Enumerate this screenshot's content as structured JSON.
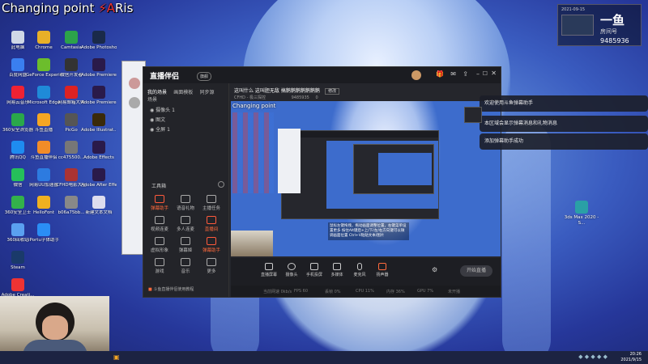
{
  "overlay": {
    "title_a": "Changing point ",
    "title_b": "Ris",
    "title_mark": "⚡A"
  },
  "desktop_icons": [
    {
      "label": "此电脑",
      "color": "#cfd8e6"
    },
    {
      "label": "百度网盘",
      "color": "#3a7ff0"
    },
    {
      "label": "网易云音乐",
      "color": "#e23"
    },
    {
      "label": "360安全浏览器",
      "color": "#2aa84a"
    },
    {
      "label": "腾讯QQ",
      "color": "#1e8cf0"
    },
    {
      "label": "微信",
      "color": "#25c05a"
    },
    {
      "label": "360安全卫士",
      "color": "#33b14a"
    },
    {
      "label": "360回收站",
      "color": "#5aa0f0"
    },
    {
      "label": "Steam",
      "color": "#1a3a6a"
    },
    {
      "label": "Adobe Creati...",
      "color": "#e33"
    },
    {
      "label": "",
      "color": "#e33"
    }
  ],
  "desktop_icons_col2": [
    {
      "label": "Chrome",
      "color": "#e8b028"
    },
    {
      "label": "GeForce Experience",
      "color": "#6cbd2c"
    },
    {
      "label": "Microsoft Edge",
      "color": "#1f8ad8"
    },
    {
      "label": "斗鱼直播",
      "color": "#f5a623"
    },
    {
      "label": "斗鱼直播伴侣",
      "color": "#f28c28"
    },
    {
      "label": "网易UU加速器",
      "color": "#2d7be0"
    },
    {
      "label": "HelloFont",
      "color": "#f0b020"
    },
    {
      "label": "iPortu字体助手",
      "color": "#2a8ef5"
    }
  ],
  "desktop_icons_col3": [
    {
      "label": "Camtasia",
      "color": "#2ca24a"
    },
    {
      "label": "微信开发者",
      "color": "#333"
    },
    {
      "label": "网易邮箱大师",
      "color": "#d22"
    },
    {
      "label": "PicGo",
      "color": "#555"
    },
    {
      "label": "cc475500...",
      "color": "#777"
    },
    {
      "label": "CFHD电影大王",
      "color": "#a33"
    },
    {
      "label": "b06a75bb...",
      "color": "#888"
    }
  ],
  "desktop_icons_col4": [
    {
      "label": "Adobe Photosho...",
      "color": "#1a2a4a"
    },
    {
      "label": "Adobe Premiere",
      "color": "#2a1a4a"
    },
    {
      "label": "Adobe Premiere Pro",
      "color": "#2a1a4a"
    },
    {
      "label": "Adobe Illustrat...",
      "color": "#3a2a0a"
    },
    {
      "label": "Adobe Effects",
      "color": "#2a1a4a"
    },
    {
      "label": "Adobe After Effects 2020",
      "color": "#2a1a4a"
    },
    {
      "label": "新建文本文档",
      "color": "#dde"
    }
  ],
  "app": {
    "logo": "直播伴侣",
    "badge": "旗舰",
    "tabs": [
      "我的场景",
      "画面模板",
      "同步源",
      "场景"
    ],
    "scenes": [
      "摄像头 1",
      "图文",
      "全屏 1"
    ],
    "room_title": "这叫什么 这叫胆无敌 搞鹅鹅鹅鹅鹅鹅鹅",
    "room_btn": "修改",
    "category": "CFHD - 极三探控",
    "room_no": "9485935",
    "fans": "0",
    "toolbox_label": "工具箱",
    "tools": [
      {
        "label": "弹幕助手",
        "hot": true
      },
      {
        "label": "语音礼物",
        "hot": false
      },
      {
        "label": "主播任务",
        "hot": false
      },
      {
        "label": "视频连麦",
        "hot": false
      },
      {
        "label": "多人连麦",
        "hot": false
      },
      {
        "label": "直播间",
        "hot": true
      },
      {
        "label": "虚拟形象",
        "hot": false
      },
      {
        "label": "弹幕姬",
        "hot": false
      },
      {
        "label": "弹幕助手",
        "hot": true
      },
      {
        "label": "游戏",
        "hot": false
      },
      {
        "label": "音乐",
        "hot": false
      },
      {
        "label": "更多",
        "hot": false
      }
    ],
    "footer_tip": "斗鱼直播伴侣使用教程",
    "controls": [
      "直播屏幕",
      "摄像头",
      "手机投屏",
      "多媒体",
      "麦克风",
      "扬声器"
    ],
    "start_btn": "开始直播",
    "preview_caption": "Changing point",
    "stream_tip": "鼠标左键拖拽，拖动画面调整位置，右键菜单设置更多 按住Alt键后+上/下/左/右方向键可以微调画面位置 Ctrl+V粘贴文本/图片",
    "status": [
      "当前网速 0kb/s",
      "FPS 60",
      "丢帧 0%",
      "CPU 11%",
      "内存 36%",
      "GPU 7%",
      "未开播"
    ]
  },
  "notifications": [
    "欢迎使用斗鱼弹幕助手",
    "本区域会显示弹幕消息和礼物消息",
    "添加弹幕助手成功"
  ],
  "room_counter": {
    "label_a": "2021-09-15",
    "label_b": "房间号",
    "room": "9485936",
    "tag": "一鱼"
  },
  "right_icon": {
    "label": "3ds Max 2020 - S..."
  },
  "taskbar": {
    "time": "20:26",
    "date": "2021/9/15"
  }
}
